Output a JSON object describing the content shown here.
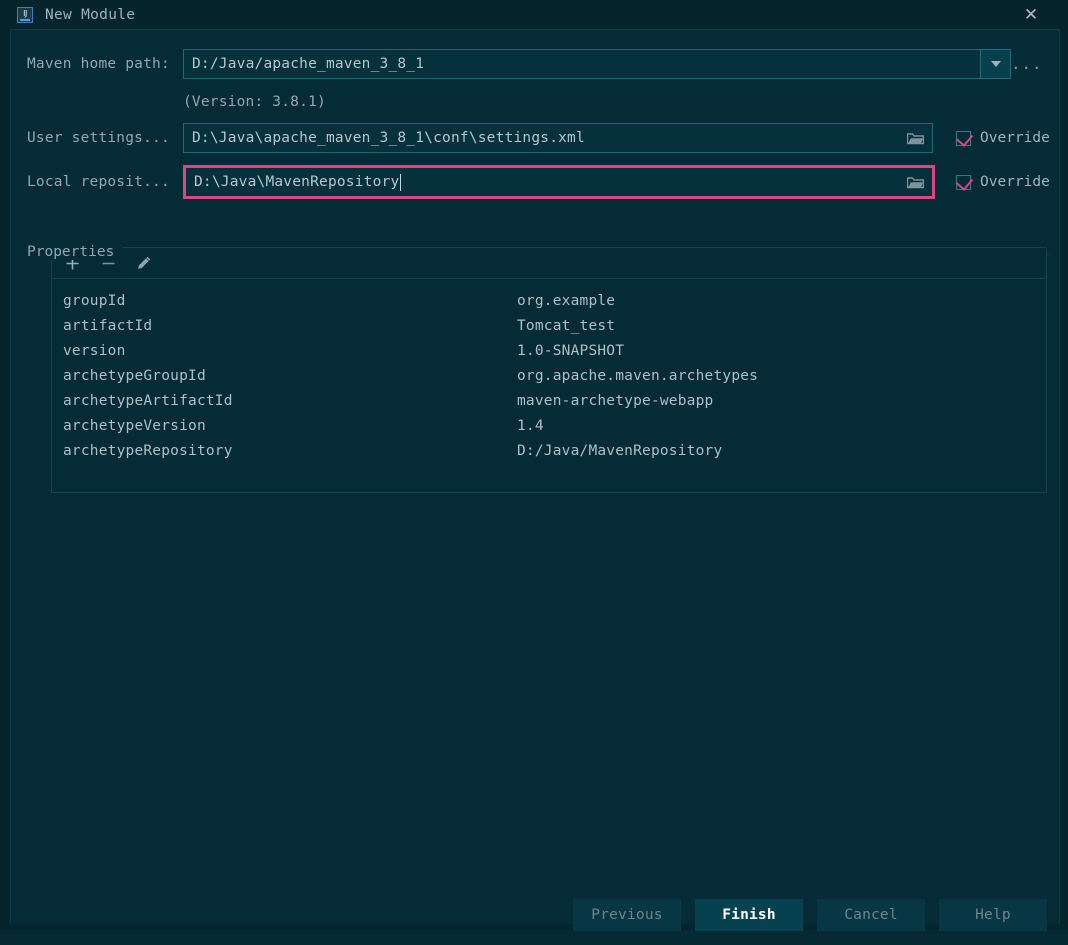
{
  "window": {
    "title": "New Module",
    "icon": "intellij-idea-icon",
    "close_icon": "close-icon"
  },
  "form": {
    "maven_home": {
      "label": "Maven home path:",
      "value": "D:/Java/apache_maven_3_8_1",
      "dropdown_icon": "chevron-down-icon",
      "browse_label": "...",
      "version_note": "(Version: 3.8.1)"
    },
    "user_settings": {
      "label": "User settings...",
      "value": "D:\\Java\\apache_maven_3_8_1\\conf\\settings.xml",
      "folder_icon": "folder-icon",
      "override_label": "Override",
      "override_checked": true
    },
    "local_repository": {
      "label": "Local reposit...",
      "value": "D:\\Java\\MavenRepository",
      "folder_icon": "folder-icon",
      "override_label": "Override",
      "override_checked": true,
      "focused": true
    }
  },
  "properties": {
    "title": "Properties",
    "toolbar": {
      "add_icon": "plus-icon",
      "remove_icon": "minus-icon",
      "edit_icon": "pencil-icon"
    },
    "rows": [
      {
        "key": "groupId",
        "value": "org.example"
      },
      {
        "key": "artifactId",
        "value": "Tomcat_test"
      },
      {
        "key": "version",
        "value": "1.0-SNAPSHOT"
      },
      {
        "key": "archetypeGroupId",
        "value": "org.apache.maven.archetypes"
      },
      {
        "key": "archetypeArtifactId",
        "value": "maven-archetype-webapp"
      },
      {
        "key": "archetypeVersion",
        "value": "1.4"
      },
      {
        "key": "archetypeRepository",
        "value": "D:/Java/MavenRepository"
      }
    ]
  },
  "footer": {
    "previous_label": "Previous",
    "finish_label": "Finish",
    "cancel_label": "Cancel",
    "help_label": "Help"
  },
  "colors": {
    "background": "#042b36",
    "titlebar": "#05242c",
    "accent_focus": "#e0457f",
    "field_border": "#1c6a7b",
    "text": "#9fb3bb"
  }
}
